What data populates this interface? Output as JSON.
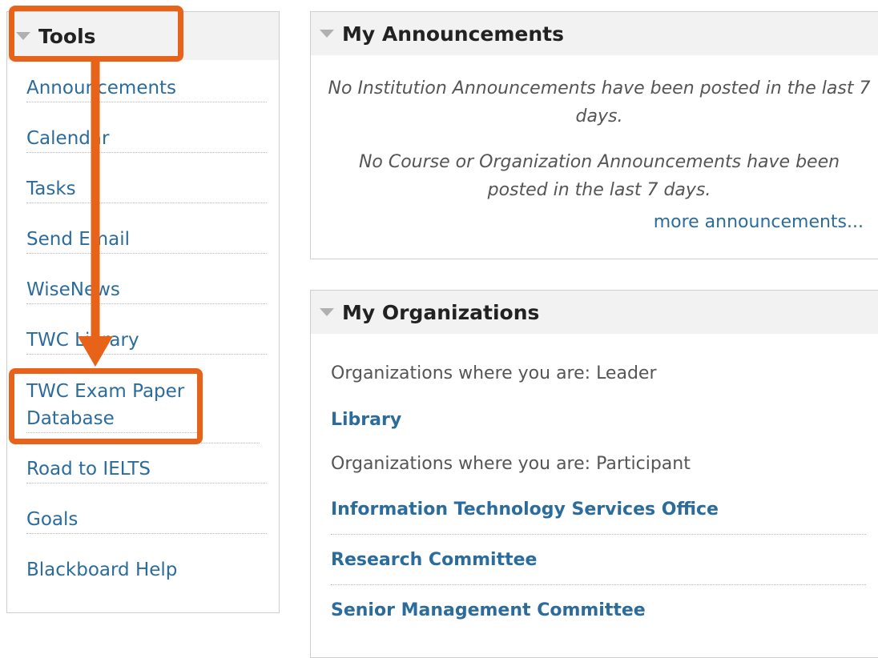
{
  "tools": {
    "title": "Tools",
    "items": [
      "Announcements",
      "Calendar",
      "Tasks",
      "Send Email",
      "WiseNews",
      "TWC Library",
      "TWC Exam Paper Database",
      "Road to IELTS",
      "Goals",
      "Blackboard Help"
    ]
  },
  "announcements": {
    "title": "My Announcements",
    "institution_message": "No Institution Announcements have been posted in the last 7 days.",
    "course_message": "No Course or Organization Announcements have been posted in the last 7 days.",
    "more_link": "more announcements..."
  },
  "organizations": {
    "title": "My Organizations",
    "leader_label": "Organizations where you are: Leader",
    "leader_orgs": [
      "Library"
    ],
    "participant_label": "Organizations where you are: Participant",
    "participant_orgs": [
      "Information Technology Services Office",
      "Research Committee",
      "Senior Management Committee"
    ]
  },
  "annotation": {
    "color": "#e8631a"
  },
  "colors": {
    "link": "#2b6c9c",
    "header_bg": "#f2f2f2"
  }
}
